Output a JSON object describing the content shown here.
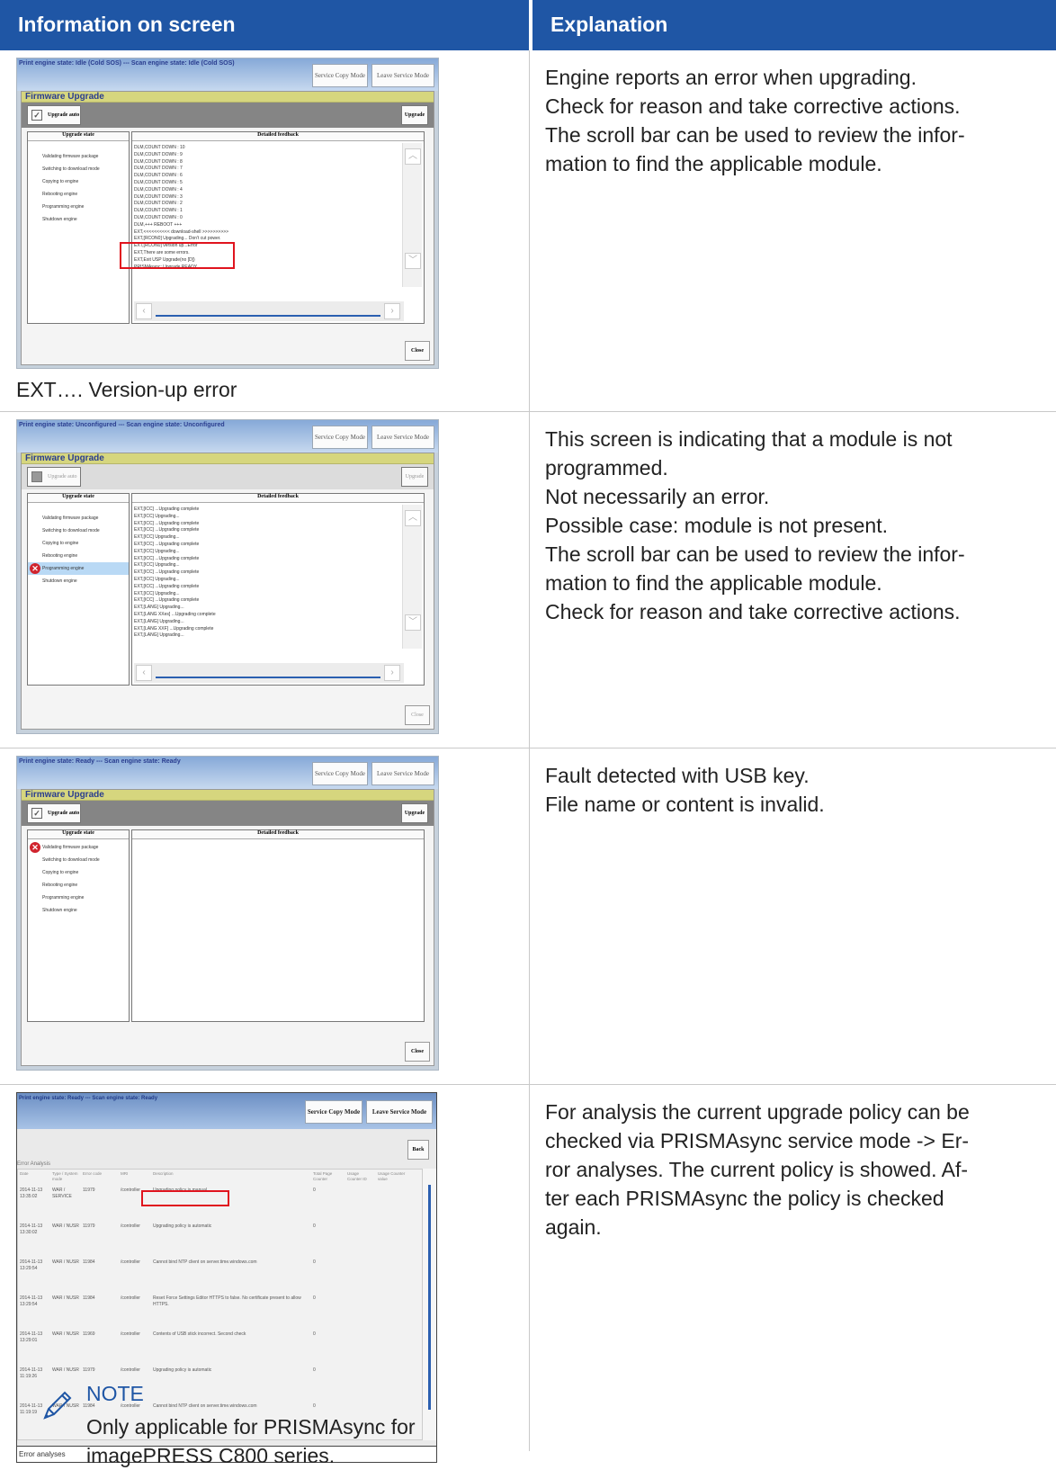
{
  "header": {
    "col_info": "Information on screen",
    "col_explanation": "Explanation"
  },
  "common": {
    "service_copy_mode": "Service Copy Mode",
    "leave_service_mode": "Leave Service Mode",
    "firmware_upgrade": "Firmware Upgrade",
    "upgrade_auto": "Upgrade auto",
    "upgrade": "Upgrade",
    "upgrade_state": "Upgrade state",
    "detailed_feedback": "Detailed feedback",
    "close": "Close",
    "states": [
      "Validating firmware package",
      "Switching to download mode",
      "Copying to engine",
      "Rebooting engine",
      "Programming engine",
      "Shutdown engine"
    ]
  },
  "rows": [
    {
      "shot_state": "Print engine state: Idle (Cold SOS) --- Scan engine state: Idle (Cold SOS)",
      "feedback": [
        "DLM,COUNT DOWN : 10",
        "DLM,COUNT DOWN : 9",
        "DLM,COUNT DOWN : 8",
        "DLM,COUNT DOWN : 7",
        "DLM,COUNT DOWN : 6",
        "DLM,COUNT DOWN : 5",
        "DLM,COUNT DOWN : 4",
        "DLM,COUNT DOWN : 3",
        "DLM,COUNT DOWN : 2",
        "DLM,COUNT DOWN : 1",
        "DLM,COUNT DOWN : 0",
        "DLM,+++ REBOOT +++",
        "EXT,<<<<<<<<<< download-shell >>>>>>>>>>",
        "EXT,[RCON0] Upgrading... Don't cut power.",
        "EXT,[RCON0] version up...Error",
        "EXT,There are some errors.",
        "EXT,Exit USP Upgrade(no [D])",
        "PRISMAsync: Upgrade READY"
      ],
      "caption": "EXT…. Version-up error",
      "explanation": [
        "Engine reports an error when upgrading.",
        "Check for reason and take corrective actions.",
        "The scroll bar can be used to review the infor-",
        "mation to find the applicable module."
      ]
    },
    {
      "shot_state": "Print engine state: Unconfigured --- Scan engine state: Unconfigured",
      "feedback": [
        "EXT,[ICC] ...Upgrading complete",
        "EXT,[ICC] Upgrading...",
        "EXT,[ICC] ...Upgrading complete",
        "EXT,[ICC] ...Upgrading complete",
        "EXT,[ICC] Upgrading...",
        "EXT,[ICC] ...Upgrading complete",
        "EXT,[ICC] Upgrading...",
        "EXT,[ICC] ...Upgrading complete",
        "EXT,[ICC] Upgrading...",
        "EXT,[ICC] ...Upgrading complete",
        "EXT,[ICC] Upgrading...",
        "EXT,[ICC] ...Upgrading complete",
        "EXT,[ICC] Upgrading...",
        "EXT,[ICC] ...Upgrading complete",
        "EXT,[LANG] Upgrading...",
        "EXT,[LANG XXes] ...Upgrading complete",
        "EXT,[LANG] Upgrading...",
        "EXT,[LANG XXF] ...Upgrading complete",
        "EXT,[LANG] Upgrading..."
      ],
      "explanation": [
        "This screen is indicating that a module is not",
        "programmed.",
        "Not necessarily an error.",
        "Possible case: module is not present.",
        "The scroll bar can be used to review the infor-",
        "mation to find the applicable module.",
        "Check for reason and take corrective actions."
      ]
    },
    {
      "shot_state": "Print engine state: Ready --- Scan engine state: Ready",
      "explanation": [
        "Fault detected with USB key.",
        "File name or content is invalid."
      ]
    },
    {
      "shot_state": "Print engine state: Ready --- Scan engine state: Ready",
      "back": "Back",
      "ea_title": "Error Analysis",
      "columns": [
        "Date",
        "Type / System mode",
        "Error code",
        "MRI",
        "Description",
        "Total Page Counter",
        "Usage Counter ID",
        "Usage Counter value"
      ],
      "entries": [
        {
          "date": "2014-11-13 13:35:02",
          "type": "WAR / SERVICE",
          "code": "11979",
          "mri": "/controller",
          "desc": "Upgrading policy is manual",
          "total": "0"
        },
        {
          "date": "2014-11-13 13:30:02",
          "type": "WAR / NUSR",
          "code": "11979",
          "mri": "/controller",
          "desc": "Upgrading policy is automatic",
          "total": "0"
        },
        {
          "date": "2014-11-13 13:29:54",
          "type": "WAR / NUSR",
          "code": "11984",
          "mri": "/controller",
          "desc": "Cannot bind NTP client on server.time.windows.com",
          "total": "0"
        },
        {
          "date": "2014-11-13 13:29:54",
          "type": "WAR / NUSR",
          "code": "11984",
          "mri": "/controller",
          "desc": "Reset Force Settings Editor HTTPS to false. No certificate present to allow HTTPS.",
          "total": "0"
        },
        {
          "date": "2014-11-13 13:29:01",
          "type": "WAR / NUSR",
          "code": "11969",
          "mri": "/controller",
          "desc": "Contents of USB stick incorrect. Second check",
          "total": "0"
        },
        {
          "date": "2014-11-13 11:19:26",
          "type": "WAR / NUSR",
          "code": "11979",
          "mri": "/controller",
          "desc": "Upgrading policy is automatic",
          "total": "0"
        },
        {
          "date": "2014-11-13 11:19:19",
          "type": "WAR / NUSR",
          "code": "11984",
          "mri": "/controller",
          "desc": "Cannot bind NTP client on server.time.windows.com",
          "total": "0"
        }
      ],
      "footer": "Error analyses",
      "explanation": [
        "For analysis the current upgrade policy can be",
        "checked via PRISMAsync service mode -> Er-",
        "ror analyses. The current policy is showed. Af-",
        "ter each PRISMAsync the policy is checked",
        "again."
      ],
      "note_title": "NOTE",
      "note_text": [
        "Only applicable for PRISMAsync for",
        "imagePRESS C800 series."
      ]
    }
  ]
}
